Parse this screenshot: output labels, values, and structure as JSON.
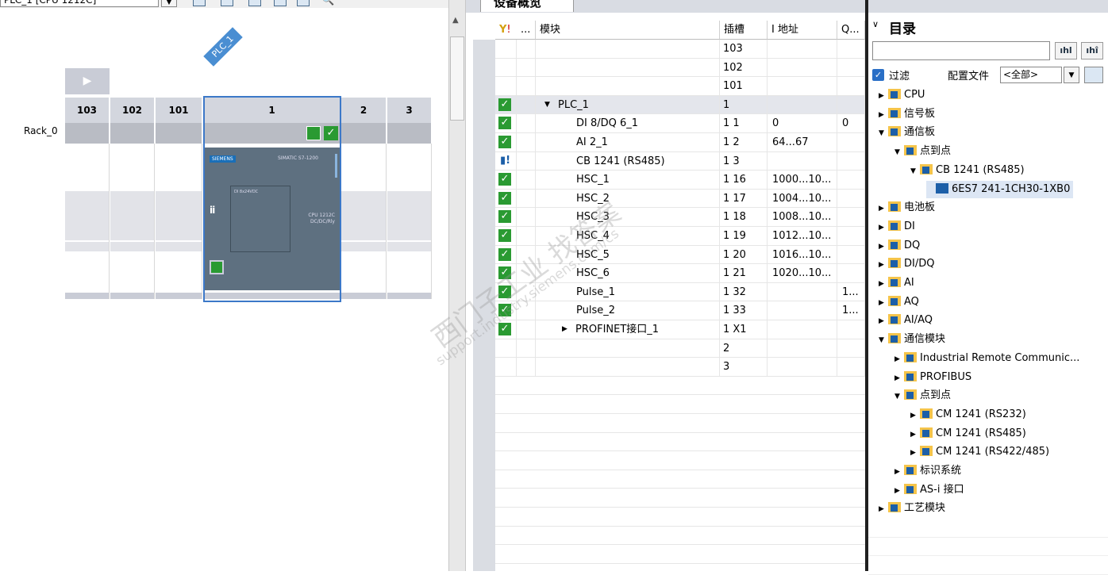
{
  "toolbar": {
    "device_select": "PLC_1 [CPU 1212C]",
    "icons": [
      "fit-icon",
      "rotate-icon",
      "view-icon",
      "grid-icon",
      "layout-icon",
      "zoom-icon"
    ]
  },
  "rack": {
    "plc_tag": "PLC_1",
    "rack_label": "Rack_0",
    "slots": [
      "103",
      "102",
      "101",
      "1",
      "2",
      "3"
    ],
    "cpu_brand": "SIEMENS",
    "cpu_model": "SIMATIC S7-1200",
    "cpu_text1": "DI 8x24VDC",
    "cpu_text2": "CPU 1212C",
    "cpu_text3": "DC/DC/Rly"
  },
  "overview": {
    "tab_label": "设备概览",
    "headers": {
      "status": "...",
      "module": "模块",
      "slot": "插槽",
      "iaddr": "I 地址",
      "qaddr": "Q..."
    },
    "rows": [
      {
        "status": "",
        "module": "",
        "slot": "103",
        "iaddr": "",
        "qaddr": "",
        "indent": 0
      },
      {
        "status": "",
        "module": "",
        "slot": "102",
        "iaddr": "",
        "qaddr": "",
        "indent": 0
      },
      {
        "status": "",
        "module": "",
        "slot": "101",
        "iaddr": "",
        "qaddr": "",
        "indent": 0
      },
      {
        "status": "ok",
        "module": "PLC_1",
        "slot": "1",
        "iaddr": "",
        "qaddr": "",
        "indent": 1,
        "expander": "▼"
      },
      {
        "status": "ok",
        "module": "DI 8/DQ 6_1",
        "slot": "1 1",
        "iaddr": "0",
        "qaddr": "0",
        "indent": 2
      },
      {
        "status": "ok",
        "module": "AI 2_1",
        "slot": "1 2",
        "iaddr": "64...67",
        "qaddr": "",
        "indent": 2
      },
      {
        "status": "info",
        "module": "CB 1241 (RS485)",
        "slot": "1 3",
        "iaddr": "",
        "qaddr": "",
        "indent": 2
      },
      {
        "status": "ok",
        "module": "HSC_1",
        "slot": "1 16",
        "iaddr": "1000...10...",
        "qaddr": "",
        "indent": 2
      },
      {
        "status": "ok",
        "module": "HSC_2",
        "slot": "1 17",
        "iaddr": "1004...10...",
        "qaddr": "",
        "indent": 2
      },
      {
        "status": "ok",
        "module": "HSC_3",
        "slot": "1 18",
        "iaddr": "1008...10...",
        "qaddr": "",
        "indent": 2
      },
      {
        "status": "ok",
        "module": "HSC_4",
        "slot": "1 19",
        "iaddr": "1012...10...",
        "qaddr": "",
        "indent": 2
      },
      {
        "status": "ok",
        "module": "HSC_5",
        "slot": "1 20",
        "iaddr": "1016...10...",
        "qaddr": "",
        "indent": 2
      },
      {
        "status": "ok",
        "module": "HSC_6",
        "slot": "1 21",
        "iaddr": "1020...10...",
        "qaddr": "",
        "indent": 2
      },
      {
        "status": "ok",
        "module": "Pulse_1",
        "slot": "1 32",
        "iaddr": "",
        "qaddr": "1...",
        "indent": 2
      },
      {
        "status": "ok",
        "module": "Pulse_2",
        "slot": "1 33",
        "iaddr": "",
        "qaddr": "1...",
        "indent": 2
      },
      {
        "status": "ok",
        "module": "PROFINET接口_1",
        "slot": "1 X1",
        "iaddr": "",
        "qaddr": "",
        "indent": 1.5,
        "expander": "▶"
      },
      {
        "status": "",
        "module": "",
        "slot": "2",
        "iaddr": "",
        "qaddr": "",
        "indent": 0
      },
      {
        "status": "",
        "module": "",
        "slot": "3",
        "iaddr": "",
        "qaddr": "",
        "indent": 0
      }
    ]
  },
  "catalog": {
    "title": "目录",
    "filter_label": "过滤",
    "profile_label": "配置文件",
    "profile_value": "<全部>",
    "items": [
      {
        "label": "CPU",
        "depth": 0,
        "exp": "▶"
      },
      {
        "label": "信号板",
        "depth": 0,
        "exp": "▶"
      },
      {
        "label": "通信板",
        "depth": 0,
        "exp": "▼"
      },
      {
        "label": "点到点",
        "depth": 1,
        "exp": "▼"
      },
      {
        "label": "CB 1241 (RS485)",
        "depth": 2,
        "exp": "▼"
      },
      {
        "label": "6ES7 241-1CH30-1XB0",
        "depth": 3,
        "exp": "",
        "selected": true
      },
      {
        "label": "电池板",
        "depth": 0,
        "exp": "▶"
      },
      {
        "label": "DI",
        "depth": 0,
        "exp": "▶"
      },
      {
        "label": "DQ",
        "depth": 0,
        "exp": "▶"
      },
      {
        "label": "DI/DQ",
        "depth": 0,
        "exp": "▶"
      },
      {
        "label": "AI",
        "depth": 0,
        "exp": "▶"
      },
      {
        "label": "AQ",
        "depth": 0,
        "exp": "▶"
      },
      {
        "label": "AI/AQ",
        "depth": 0,
        "exp": "▶"
      },
      {
        "label": "通信模块",
        "depth": 0,
        "exp": "▼"
      },
      {
        "label": "Industrial Remote Communic...",
        "depth": 1,
        "exp": "▶"
      },
      {
        "label": "PROFIBUS",
        "depth": 1,
        "exp": "▶"
      },
      {
        "label": "点到点",
        "depth": 1,
        "exp": "▼"
      },
      {
        "label": "CM 1241 (RS232)",
        "depth": 2,
        "exp": "▶"
      },
      {
        "label": "CM 1241 (RS485)",
        "depth": 2,
        "exp": "▶"
      },
      {
        "label": "CM 1241 (RS422/485)",
        "depth": 2,
        "exp": "▶"
      },
      {
        "label": "标识系统",
        "depth": 1,
        "exp": "▶"
      },
      {
        "label": "AS-i 接口",
        "depth": 1,
        "exp": "▶"
      },
      {
        "label": "工艺模块",
        "depth": 0,
        "exp": "▶"
      }
    ]
  },
  "watermark": {
    "line1": "西门子工业 找答案",
    "line2": "support.industry.siemens.com/cs"
  },
  "colors": {
    "ok": "#2a9a32",
    "selection": "#3c78c8",
    "folder": "#f5c44a"
  }
}
